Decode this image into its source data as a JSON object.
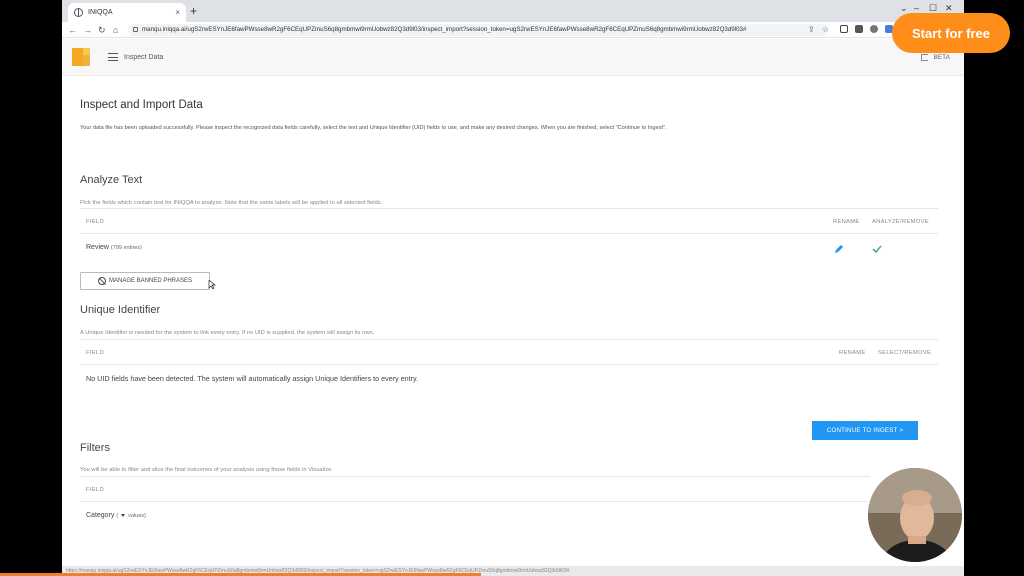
{
  "browser": {
    "tab_title": "INIQQA",
    "tab_close": "×",
    "new_tab": "+",
    "url": "manqu.iniqqa.ai/ugS2rwESYnJE6fawPWsse8wR2gF6CEqUPZmuS6q8gmbmwi9rmUobwz82Q3d9l03/inspect_import?session_token=ugS2rwESYnJE6fawPWsse8wR2gF6CEqUPZmuS6q8gmbmwi9rmUobwz82Q3d9l03#",
    "status_url": "https://manqu.iniqqa.ai/ugS2rwESYnJE6fawPWsse8wR2gF6CEqUPZmuS6q8gmbmwi9rmUobwz82Q3d9l03/inspect_import?session_token=ugS2rwESYnJE6fawPWsse8wR2gF6CEqUPZmuS6q8gmbmwi9rmUobwz82Q3d9l03#",
    "progress": 0.47
  },
  "header": {
    "title": "Inspect Data",
    "beta": "BETA"
  },
  "page": {
    "title": "Inspect and Import Data",
    "description": "Your data file has been uploaded successfully. Please inspect the recognized data fields carefully, select the text and Unique Identifier (UID) fields to use, and make any desired changes. When you are finished, select \"Continue to Ingest\"."
  },
  "analyze": {
    "title": "Analyze Text",
    "description": "Pick the fields which contain text for INIQQA to analyze. Note that the same labels will be applied to all selected fields.",
    "col_field": "FIELD",
    "col_rename": "RENAME",
    "col_action": "ANALYZE/REMOVE",
    "row_name": "Review",
    "row_count": "(799 entries)",
    "banned_button": "MANAGE BANNED PHRASES"
  },
  "uid": {
    "title": "Unique Identifier",
    "description": "A Unique Identifier is needed for the system to link every entry. If no UID is supplied, the system will assign its own.",
    "col_field": "FIELD",
    "col_rename": "RENAME",
    "col_action": "SELECT/REMOVE",
    "empty_message": "No UID fields have been detected. The system will automatically assign Unique Identifiers to every entry."
  },
  "continue_button": "CONTINUE TO INGEST >",
  "filters": {
    "title": "Filters",
    "description": "You will be able to filter and slice the final outcomes of your analysis using those fields in Visualize.",
    "col_field": "FIELD",
    "row_name": "Category",
    "row_open": "(",
    "row_suffix": "values)"
  },
  "overlay": {
    "cta": "Start for free"
  },
  "colors": {
    "primary": "#2196f3",
    "cta": "#ff8d1a",
    "logo": "#f5a623",
    "check": "#2e9e7a"
  }
}
